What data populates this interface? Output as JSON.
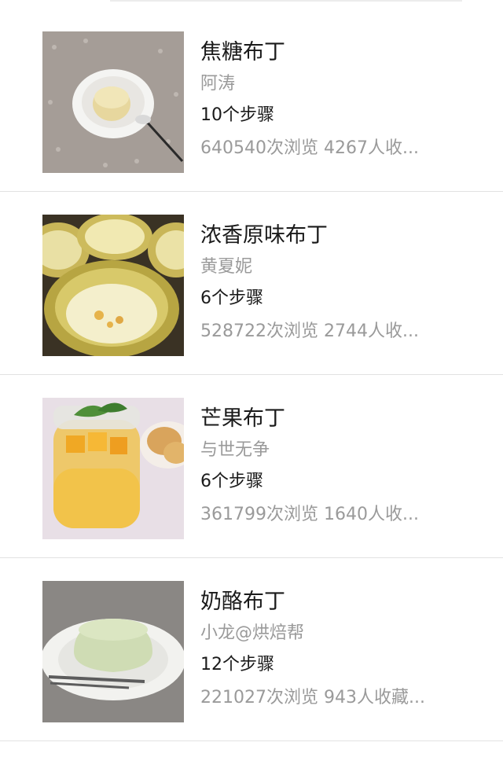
{
  "recipes": [
    {
      "title": "焦糖布丁",
      "author": "阿涛",
      "steps": "10个步骤",
      "stats": "640540次浏览 4267人收...",
      "image": "caramel-pudding-photo"
    },
    {
      "title": "浓香原味布丁",
      "author": "黄夏妮",
      "steps": "6个步骤",
      "stats": "528722次浏览 2744人收...",
      "image": "original-pudding-photo"
    },
    {
      "title": "芒果布丁",
      "author": "与世无争",
      "steps": "6个步骤",
      "stats": "361799次浏览 1640人收...",
      "image": "mango-pudding-photo"
    },
    {
      "title": "奶酪布丁",
      "author": "小龙@烘焙帮",
      "steps": "12个步骤",
      "stats": "221027次浏览 943人收藏...",
      "image": "cheese-pudding-photo"
    }
  ]
}
